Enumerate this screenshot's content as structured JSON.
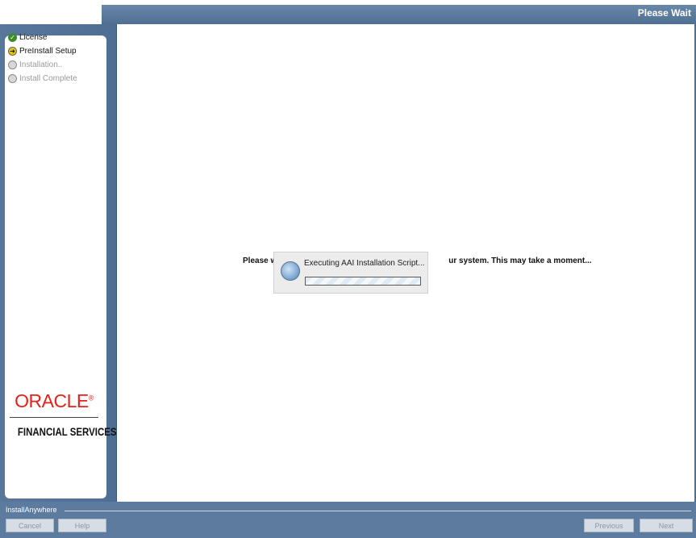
{
  "window": {
    "title": "Please Wait"
  },
  "steps": [
    {
      "label": "License",
      "state": "done",
      "icon": "check-icon"
    },
    {
      "label": "PreInstall Setup",
      "state": "current",
      "icon": "arrow-right-icon"
    },
    {
      "label": "Installation..",
      "state": "pending",
      "icon": "pending-circle-icon"
    },
    {
      "label": "Install Complete",
      "state": "pending",
      "icon": "pending-circle-icon"
    }
  ],
  "logo": {
    "oracle": "ORACLE",
    "registered": "®",
    "subtitle": "FINANCIAL SERVICES"
  },
  "main": {
    "message_left": "Please w",
    "message_right": "ur system.  This may take a moment...",
    "popup": {
      "text": "Executing AAI Installation Script...",
      "icon": "installer-globe-icon",
      "progress": "indeterminate"
    }
  },
  "footer": {
    "brand": "InstallAnywhere",
    "cancel": "Cancel",
    "help": "Help",
    "previous": "Previous",
    "next": "Next"
  },
  "colors": {
    "frame": "#4e6e93",
    "oracle_red": "#e2231a",
    "done": "#3d8c2c",
    "current": "#e8c500"
  }
}
